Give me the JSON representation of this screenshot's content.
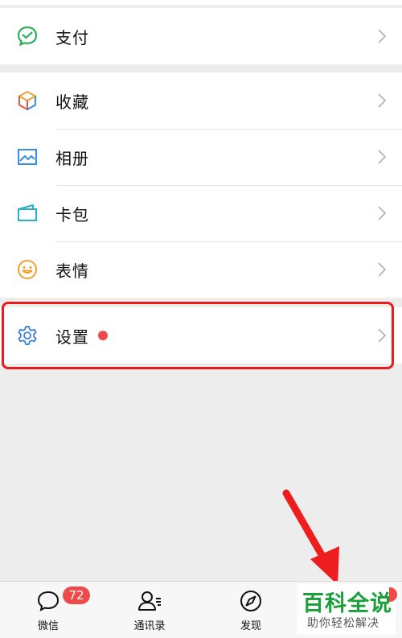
{
  "menu": {
    "pay": {
      "label": "支付"
    },
    "favorites": {
      "label": "收藏"
    },
    "album": {
      "label": "相册"
    },
    "cards": {
      "label": "卡包"
    },
    "stickers": {
      "label": "表情"
    },
    "settings": {
      "label": "设置"
    }
  },
  "tabbar": {
    "chats": {
      "label": "微信",
      "badge": "72"
    },
    "contacts": {
      "label": "通讯录"
    },
    "discover": {
      "label": "发现"
    }
  },
  "watermark": {
    "title": "百科全说",
    "subtitle": "助你轻松解决"
  },
  "colors": {
    "accent_red": "#ef4a4a",
    "highlight_red": "#ea1b1b",
    "brand_green": "#1aa038"
  }
}
